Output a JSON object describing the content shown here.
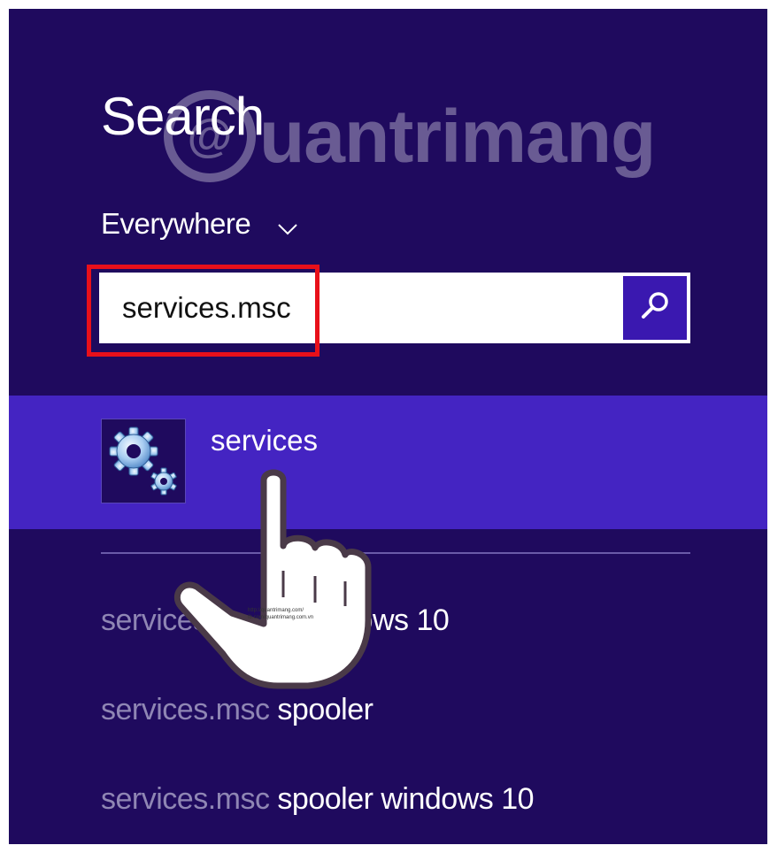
{
  "watermark": {
    "logo_glyph": "@",
    "text": "uantrimang"
  },
  "search": {
    "title": "Search",
    "scope_label": "Everywhere",
    "query": "services.msc"
  },
  "results": {
    "top_match": {
      "label": "services",
      "icon": "gear-icon"
    }
  },
  "suggestions": [
    {
      "query_part": "services.",
      "rest": "ows 10"
    },
    {
      "query_part": "services.msc",
      "rest": " spooler"
    },
    {
      "query_part": "services.msc",
      "rest": " spooler windows 10"
    }
  ],
  "overlay": {
    "hand_caption_1": "http://quantrimang.com/",
    "hand_caption_2": "fb.com/quantrimang.com.vn"
  },
  "colors": {
    "background": "#1f0a5e",
    "selected_result": "#4424c2",
    "search_button": "#3a18b0",
    "highlight": "#e8101a"
  }
}
